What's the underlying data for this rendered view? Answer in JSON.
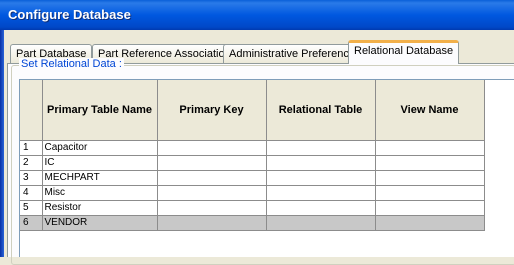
{
  "window": {
    "title": "Configure Database"
  },
  "tabs": [
    {
      "label": "Part Database"
    },
    {
      "label": "Part Reference Associations"
    },
    {
      "label": "Administrative Preferences"
    },
    {
      "label": "Relational Database"
    }
  ],
  "active_tab": "Relational Database",
  "group": {
    "label": "Set Relational Data :"
  },
  "grid": {
    "columns": [
      "Primary Table Name",
      "Primary Key",
      "Relational Table",
      "View Name"
    ],
    "rows": [
      {
        "num": "1",
        "primary_table_name": "Capacitor",
        "primary_key": "",
        "relational_table": "",
        "view_name": ""
      },
      {
        "num": "2",
        "primary_table_name": "IC",
        "primary_key": "",
        "relational_table": "",
        "view_name": ""
      },
      {
        "num": "3",
        "primary_table_name": "MECHPART",
        "primary_key": "",
        "relational_table": "",
        "view_name": ""
      },
      {
        "num": "4",
        "primary_table_name": "Misc",
        "primary_key": "",
        "relational_table": "",
        "view_name": ""
      },
      {
        "num": "5",
        "primary_table_name": "Resistor",
        "primary_key": "",
        "relational_table": "",
        "view_name": ""
      },
      {
        "num": "6",
        "primary_table_name": "VENDOR",
        "primary_key": "",
        "relational_table": "",
        "view_name": ""
      }
    ],
    "selected_row": "6"
  }
}
